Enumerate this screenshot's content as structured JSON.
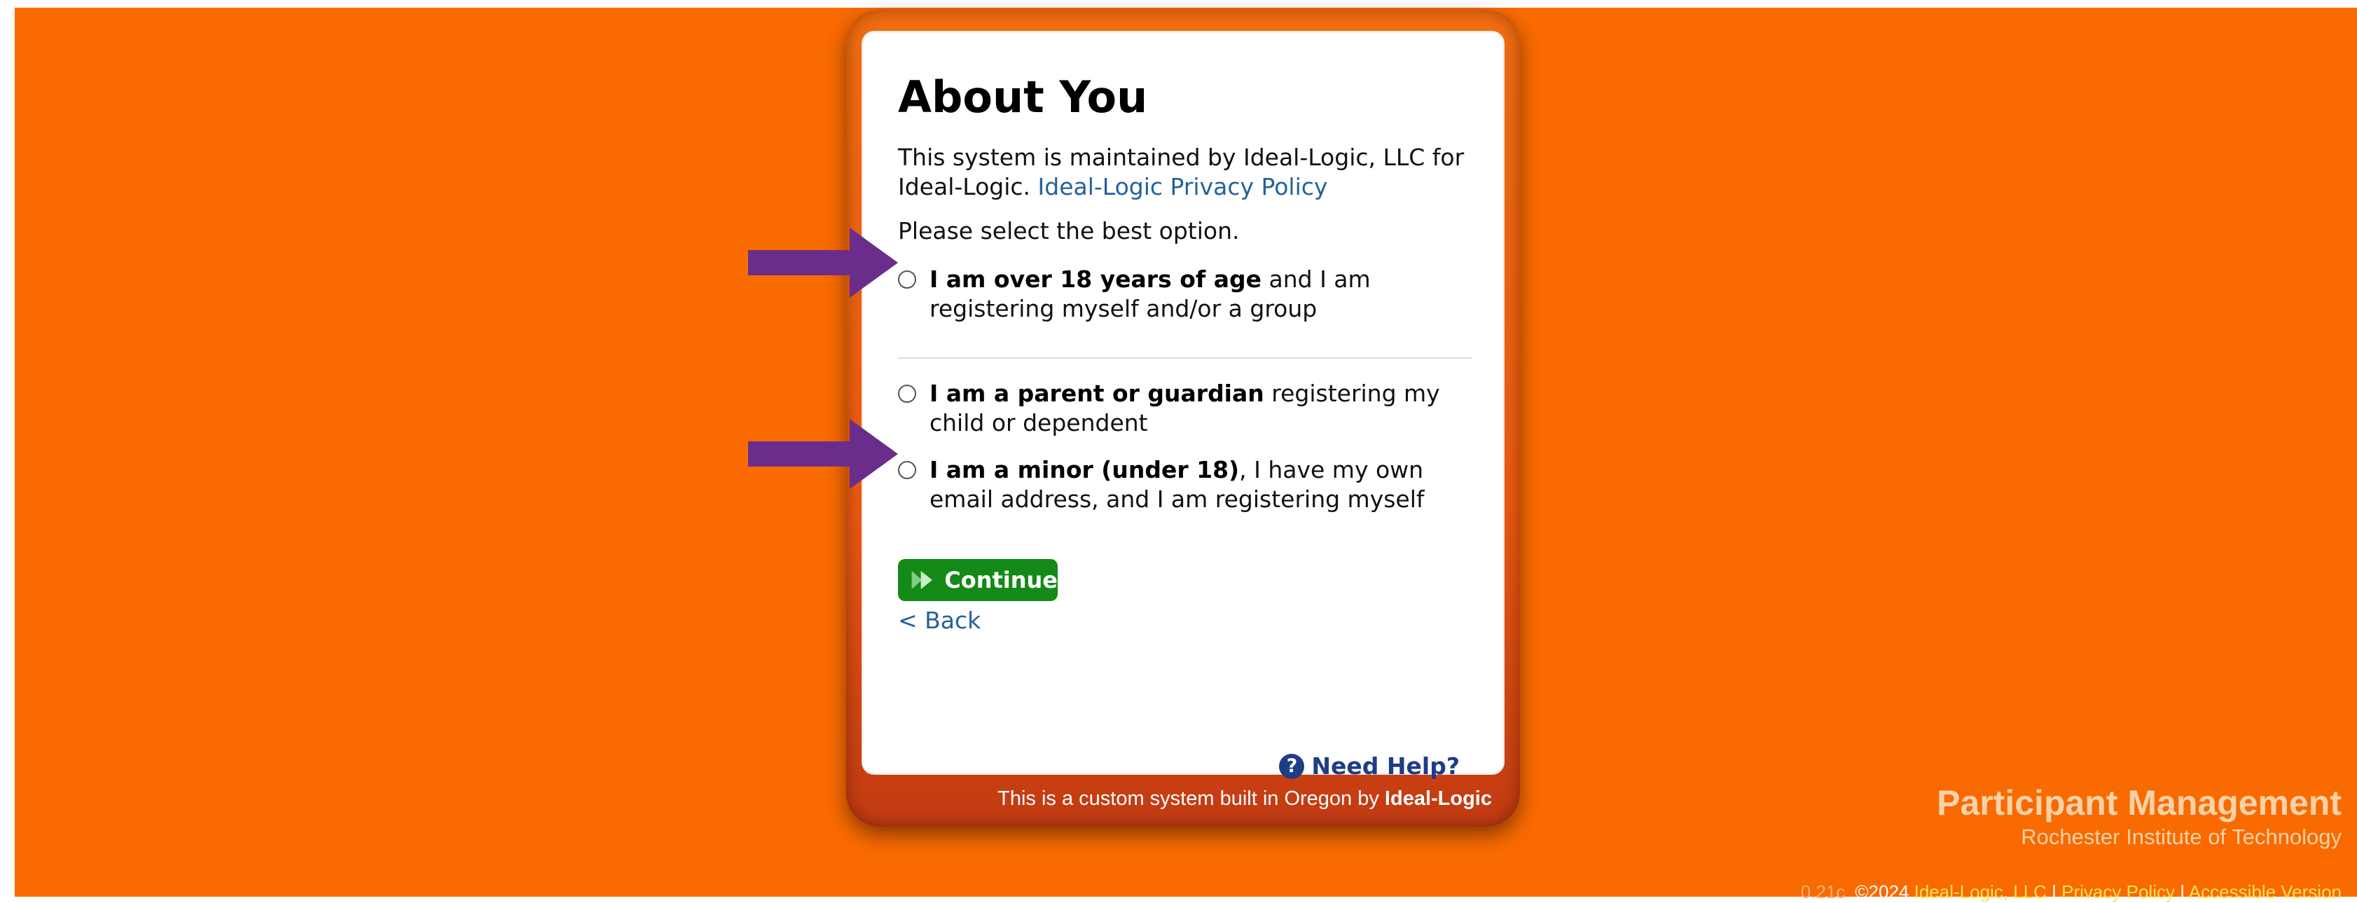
{
  "page": {
    "title": "About You",
    "maintenance_prefix": "This system is maintained by Ideal-Logic, LLC for Ideal-Logic. ",
    "privacy_link": "Ideal-Logic Privacy Policy",
    "prompt": "Please select the best option."
  },
  "options": [
    {
      "bold": "I am over 18 years of age",
      "rest": " and I am registering myself and/or a group",
      "selected": false
    },
    {
      "bold": "I am a parent or guardian",
      "rest": " registering my child or dependent",
      "selected": false
    },
    {
      "bold": "I am a minor (under 18)",
      "rest": ", I have my own email address, and I am registering myself",
      "selected": false
    }
  ],
  "actions": {
    "continue": "Continue",
    "back": "< Back",
    "help": "Need Help?"
  },
  "card_footer": {
    "prefix": "This is a custom system built in Oregon by ",
    "brand": "Ideal-Logic"
  },
  "branding": {
    "product": "Participant Management",
    "org": "Rochester Institute of Technology"
  },
  "footer": {
    "version": "0.21c",
    "copyright": "©2024",
    "company_link": "Ideal-Logic, LLC",
    "sep1": " | ",
    "privacy_link": "Privacy Policy",
    "sep2": " | ",
    "accessible_link": "Accessible Version"
  },
  "colors": {
    "background": "#f96a00",
    "arrow": "#6b2d8c",
    "continue_button": "#138a17",
    "link": "#24619c"
  },
  "icons": [
    "continue-arrows-icon",
    "help-question-icon",
    "annotation-arrow-icon"
  ]
}
